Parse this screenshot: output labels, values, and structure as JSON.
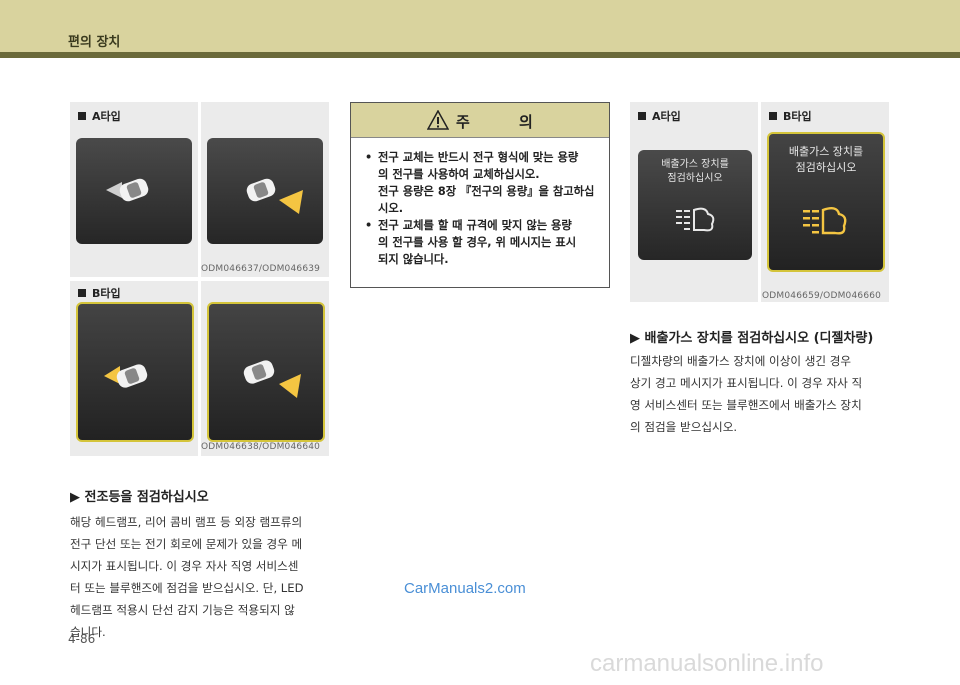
{
  "header": {
    "title": "편의 장치"
  },
  "left": {
    "type_a_label": "A타입",
    "type_b_label": "B타입",
    "code_a": "ODM046637/ODM046639",
    "code_b": "ODM046638/ODM046640",
    "section_title": "▶ 전조등을 점검하십시오",
    "body_lines": [
      "해당 헤드램프, 리어 콤비 램프 등 외장 램프류의",
      "전구 단선 또는 전기 회로에 문제가 있을 경우 메",
      "시지가 표시됩니다. 이 경우 자사 직영 서비스센",
      "터 또는 블루핸즈에 점검을 받으십시오. 단, LED",
      "헤드램프 적용시 단선 감지 기능은 적용되지 않",
      "습니다."
    ]
  },
  "caution": {
    "title": "주 의",
    "items": [
      [
        "전구 교체는 반드시 전구 형식에 맞는 용량",
        "의 전구를 사용하여 교체하십시오.",
        "전구 용량은 8장 『전구의 용량』을 참고하십",
        "시오."
      ],
      [
        "전구 교체를 할 때 규격에 맞지 않는 용량",
        "의 전구를 사용 할 경우, 위 메시지는 표시",
        "되지 않습니다."
      ]
    ]
  },
  "right": {
    "type_a_label": "A타입",
    "type_b_label": "B타입",
    "msg_line1": "배출가스 장치를",
    "msg_line2": "점검하십시오",
    "code": "ODM046659/ODM046660",
    "section_title": "▶ 배출가스 장치를 점검하십시오 (디젤차량)",
    "body_lines": [
      "디젤차량의 배출가스 장치에 이상이 생긴 경우",
      "상기 경고 메시지가 표시됩니다. 이 경우 자사 직",
      "영 서비스센터 또는 블루핸즈에서 배출가스 장치",
      "의 점검을 받으십시오."
    ]
  },
  "page_number": "4-86",
  "watermark": "CarManuals2.com",
  "footer_watermark": "carmanualsonline.info",
  "colors": {
    "header_bg": "#d9d39e",
    "header_bar": "#6b6a3a",
    "amber": "#f4c542",
    "frame_yellow": "#d4c43a"
  }
}
